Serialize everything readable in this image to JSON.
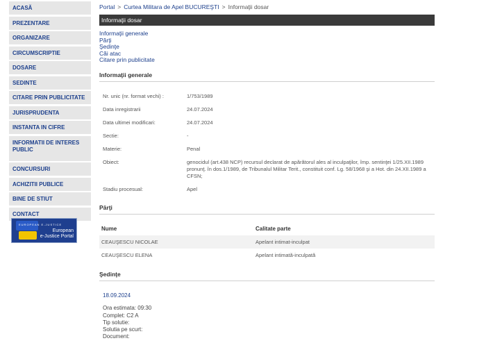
{
  "sidebar": {
    "items": [
      {
        "label": "ACASĂ"
      },
      {
        "label": "PREZENTARE"
      },
      {
        "label": "ORGANIZARE"
      },
      {
        "label": "CIRCUMSCRIPTIE"
      },
      {
        "label": "DOSARE"
      },
      {
        "label": "SEDINTE"
      },
      {
        "label": "CITARE PRIN PUBLICITATE"
      },
      {
        "label": "JURISPRUDENTA"
      },
      {
        "label": "INSTANTA IN CIFRE"
      },
      {
        "label": "INFORMATII DE INTERES PUBLIC"
      },
      {
        "label": "CONCURSURI"
      },
      {
        "label": "ACHIZITII PUBLICE"
      },
      {
        "label": "BINE DE STIUT"
      },
      {
        "label": "CONTACT"
      }
    ],
    "ejustice": {
      "small": "EUROPEAN E-JUSTICE",
      "line1": "European",
      "line2": "e-Justice Portal"
    }
  },
  "breadcrumb": {
    "portal": "Portal",
    "court": "Curtea Militara de Apel BUCUREŞTI",
    "current": "Informaţii dosar",
    "sep": ">"
  },
  "page_title": "Informaţii dosar",
  "anchors": [
    "Informaţii generale",
    "Părţi",
    "Şedinţe",
    "Căi atac",
    "Citare prin publicitate"
  ],
  "general": {
    "heading": "Informaţii generale",
    "fields": [
      {
        "label": "Nr. unic (nr. format vechi) :",
        "value": "1/753/1989"
      },
      {
        "label": "Data inregistrarii",
        "value": "24.07.2024"
      },
      {
        "label": "Data ultimei modificari:",
        "value": "24.07.2024"
      },
      {
        "label": "Sectie:",
        "value": "-"
      },
      {
        "label": "Materie:",
        "value": "Penal"
      },
      {
        "label": "Obiect:",
        "value": "genocidul (art.438 NCP) recursul declarat de apărătorul ales al inculpaţilor, împ. sentinţei 1/25.XII.1989 pronunţ. în dos.1/1989, de Tribunalul Militar Terit., constituit conf. Lg. 58/1968 şi a Hot. din 24.XII.1989 a CFSN;"
      },
      {
        "label": "Stadiu procesual:",
        "value": "Apel"
      }
    ]
  },
  "parti": {
    "heading": "Părţi",
    "columns": [
      "Nume",
      "Calitate parte"
    ],
    "rows": [
      [
        "CEAUŞESCU NICOLAE",
        "Apelant intimat-inculpat"
      ],
      [
        "CEAUŞESCU ELENA",
        "Apelant intimată-inculpată"
      ]
    ]
  },
  "sedinte": {
    "heading": "Şedinţe",
    "date": "18.09.2024",
    "details": [
      "Ora estimata: 09:30",
      "Complet: C2 A",
      "Tip solutie:",
      "Solutia pe scurt:",
      "Document:"
    ]
  }
}
